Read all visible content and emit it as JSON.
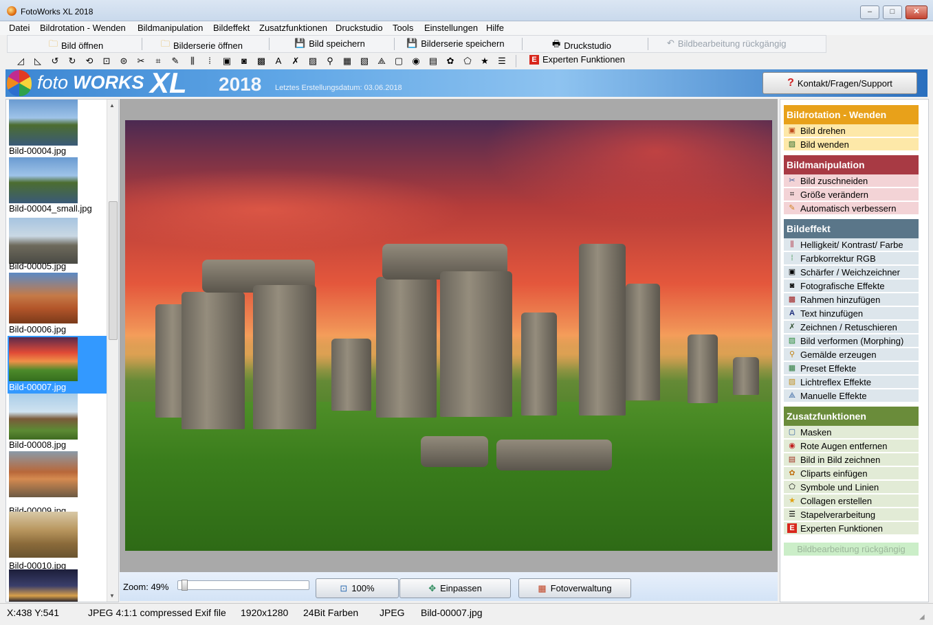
{
  "window": {
    "title": "FotoWorks XL 2018",
    "minimize": "–",
    "maximize": "□",
    "close": "✕"
  },
  "menu": [
    "Datei",
    "Bildrotation - Wenden",
    "Bildmanipulation",
    "Bildeffekt",
    "Zusatzfunktionen",
    "Druckstudio",
    "Tools",
    "Einstellungen",
    "Hilfe"
  ],
  "toolbar": {
    "open_image": "Bild öffnen",
    "open_series": "Bilderserie öffnen",
    "save_image": "Bild speichern",
    "save_series": "Bilderserie speichern",
    "print_studio": "Druckstudio",
    "undo": "Bildbearbeitung rückgängig",
    "expert": "Experten Funktionen"
  },
  "banner": {
    "logo_foto": "foto",
    "logo_works": "WORKS",
    "logo_xl": "XL",
    "logo_year": "2018",
    "build_date": "Letztes Erstellungsdatum: 03.06.2018",
    "support": "Kontakt/Fragen/Support"
  },
  "thumbnails": [
    {
      "label": "Bild-00004.jpg"
    },
    {
      "label": "Bild-00004_small.jpg"
    },
    {
      "label": "Bild-00005.jpg"
    },
    {
      "label": "Bild-00006.jpg"
    },
    {
      "label": "Bild-00007.jpg",
      "selected": true
    },
    {
      "label": "Bild-00008.jpg"
    },
    {
      "label": "Bild-00009.jpg"
    },
    {
      "label": "Bild-00010.jpg"
    }
  ],
  "zoom": {
    "label": "Zoom: 49%",
    "level_percent": 49,
    "btn_100": "100%",
    "btn_fit": "Einpassen",
    "btn_manage": "Fotoverwaltung"
  },
  "sections": [
    {
      "title": "Bildrotation - Wenden",
      "color": "#e8a11a",
      "item_bg": "#fde8a8",
      "items": [
        "Bild drehen",
        "Bild wenden"
      ]
    },
    {
      "title": "Bildmanipulation",
      "color": "#a83a44",
      "item_bg": "#f3d3d6",
      "items": [
        "Bild zuschneiden",
        "Größe verändern",
        "Automatisch verbessern"
      ]
    },
    {
      "title": "Bildeffekt",
      "color": "#5a7689",
      "item_bg": "#dde6ec",
      "items": [
        "Helligkeit/ Kontrast/ Farbe",
        "Farbkorrektur RGB",
        "Schärfer / Weichzeichner",
        "Fotografische Effekte",
        "Rahmen hinzufügen",
        "Text hinzufügen",
        "Zeichnen / Retuschieren",
        "Bild verformen (Morphing)",
        "Gemälde erzeugen",
        "Preset Effekte",
        "Lichtreflex Effekte",
        "Manuelle Effekte"
      ]
    },
    {
      "title": "Zusatzfunktionen",
      "color": "#6a8c3a",
      "item_bg": "#e2ebd6",
      "items": [
        "Masken",
        "Rote Augen entfernen",
        "Bild in Bild zeichnen",
        "Cliparts einfügen",
        "Symbole und Linien",
        "Collagen erstellen",
        "Stapelverarbeitung",
        "Experten Funktionen"
      ]
    }
  ],
  "undo_right": "Bildbearbeitung rückgängig",
  "status": {
    "coords": "X:438 Y:541",
    "format": "JPEG 4:1:1 compressed Exif file",
    "size": "1920x1280",
    "colors": "24Bit Farben",
    "type": "JPEG",
    "file": "Bild-00007.jpg"
  }
}
